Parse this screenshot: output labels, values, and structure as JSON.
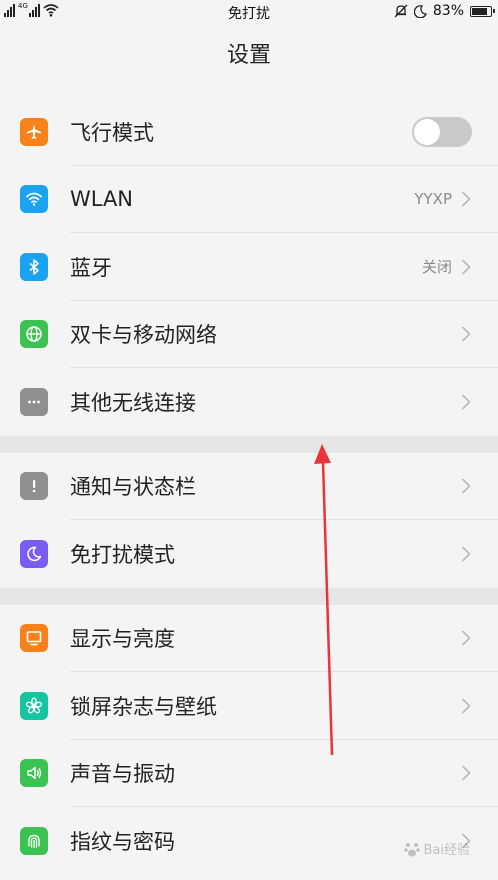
{
  "status_bar": {
    "time_center": "免打扰",
    "battery": "83%",
    "network_tag": "4G"
  },
  "title": "设置",
  "groups": [
    [
      {
        "name": "airplane",
        "label": "飞行模式",
        "value": "",
        "icon": "airplane-icon",
        "color": "#f7821b",
        "control": "toggle",
        "toggle_on": false
      },
      {
        "name": "wlan",
        "label": "WLAN",
        "value": "YYXP",
        "icon": "wifi-icon",
        "color": "#1aa3f0",
        "control": "chevron"
      },
      {
        "name": "bluetooth",
        "label": "蓝牙",
        "value": "关闭",
        "icon": "bluetooth-icon",
        "color": "#1aa3f0",
        "control": "chevron"
      },
      {
        "name": "dual-sim",
        "label": "双卡与移动网络",
        "value": "",
        "icon": "globe-icon",
        "color": "#3cc251",
        "control": "chevron"
      },
      {
        "name": "other-wireless",
        "label": "其他无线连接",
        "value": "",
        "icon": "more-icon",
        "color": "#8f8f8f",
        "control": "chevron"
      }
    ],
    [
      {
        "name": "notifications",
        "label": "通知与状态栏",
        "value": "",
        "icon": "alert-icon",
        "color": "#8f8f8f",
        "control": "chevron"
      },
      {
        "name": "dnd",
        "label": "免打扰模式",
        "value": "",
        "icon": "moon-icon",
        "color": "#7b5cf0",
        "control": "chevron"
      }
    ],
    [
      {
        "name": "display",
        "label": "显示与亮度",
        "value": "",
        "icon": "monitor-icon",
        "color": "#f7821b",
        "control": "chevron"
      },
      {
        "name": "lockscreen",
        "label": "锁屏杂志与壁纸",
        "value": "",
        "icon": "flower-icon",
        "color": "#17c4a0",
        "control": "chevron"
      },
      {
        "name": "sound",
        "label": "声音与振动",
        "value": "",
        "icon": "speaker-icon",
        "color": "#3cc251",
        "control": "chevron"
      },
      {
        "name": "fingerprint",
        "label": "指纹与密码",
        "value": "",
        "icon": "fingerprint-icon",
        "color": "#3cc251",
        "control": "chevron"
      }
    ]
  ],
  "watermark": "Bai经验"
}
